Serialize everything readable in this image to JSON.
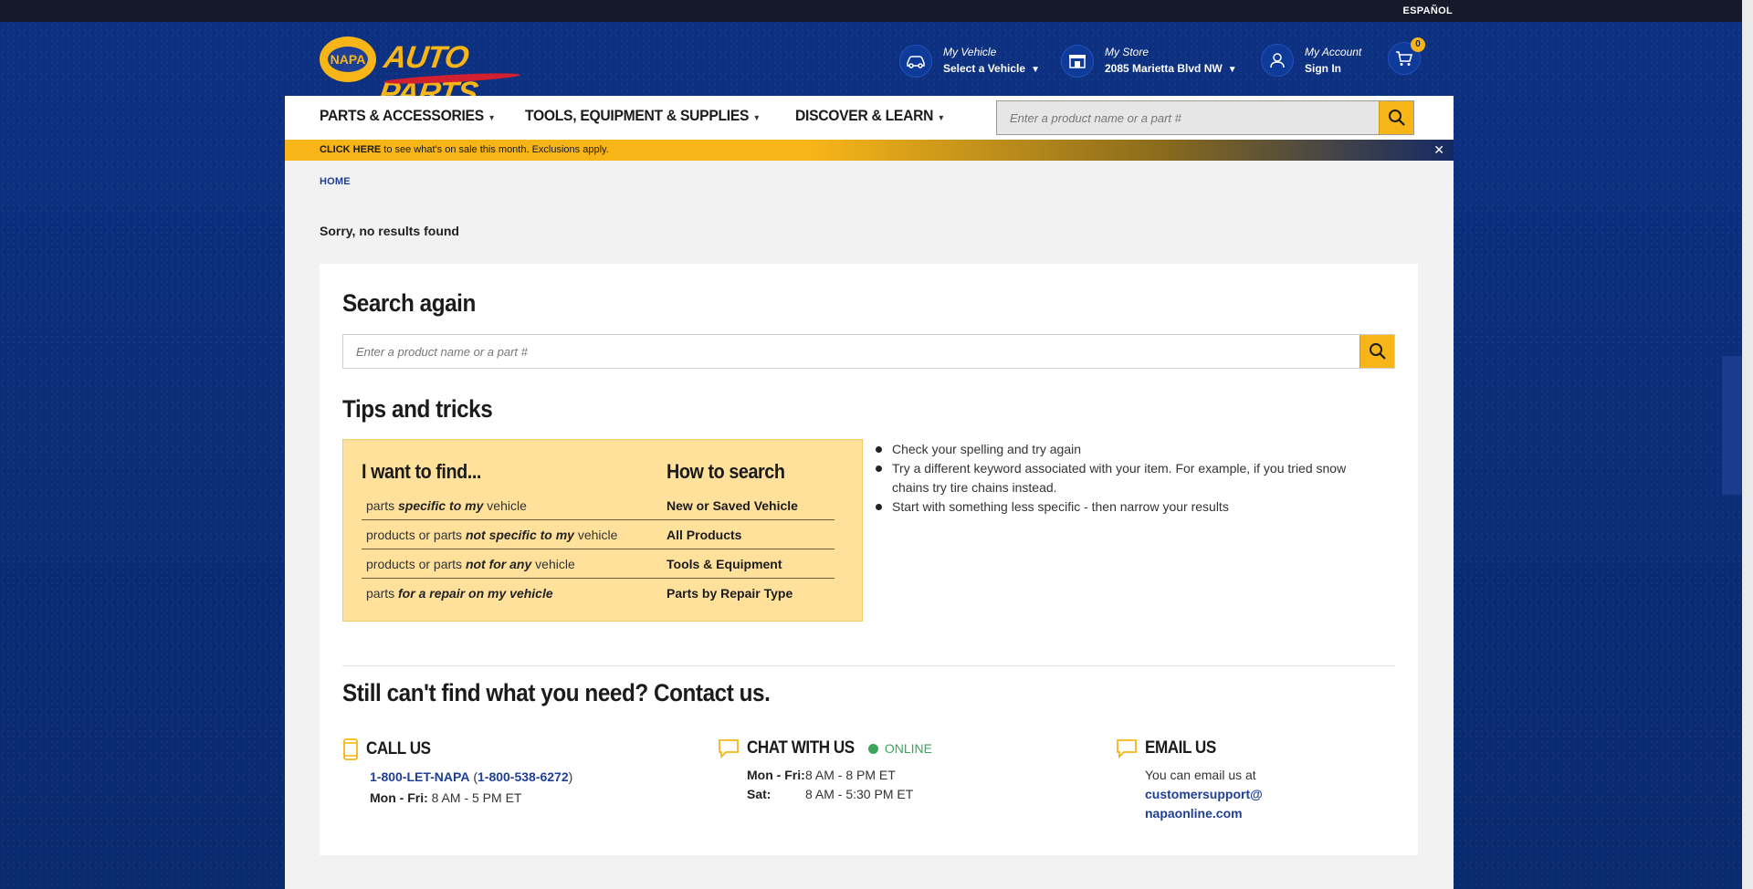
{
  "topbar": {
    "language": "ESPAÑOL"
  },
  "logo": {
    "badge": "NAPA",
    "text": "AUTO PARTS"
  },
  "header": {
    "vehicle": {
      "label": "My Vehicle",
      "value": "Select a Vehicle"
    },
    "store": {
      "label": "My Store",
      "value": "2085 Marietta Blvd NW"
    },
    "account": {
      "label": "My Account",
      "value": "Sign In"
    },
    "cart_count": "0"
  },
  "nav": {
    "items": [
      "PARTS & ACCESSORIES",
      "TOOLS, EQUIPMENT & SUPPLIES",
      "DISCOVER & LEARN"
    ],
    "search_placeholder": "Enter a product name or a part #"
  },
  "promo": {
    "link": "CLICK HERE",
    "text": " to see what's on sale this month. Exclusions apply.",
    "close": "✕"
  },
  "breadcrumb": "HOME",
  "no_results": "Sorry, no results found",
  "search_again": {
    "title": "Search again",
    "placeholder": "Enter a product name or a part #"
  },
  "tips": {
    "title": "Tips and tricks",
    "head_left": "I want to find...",
    "head_right": "How to search",
    "rows": [
      {
        "pre": "parts ",
        "em": "specific to my",
        "post": " vehicle",
        "method": "New or Saved Vehicle"
      },
      {
        "pre": "products or parts ",
        "em": "not specific to my",
        "post": " vehicle",
        "method": "All Products"
      },
      {
        "pre": "products or parts ",
        "em": "not for any",
        "post": " vehicle",
        "method": "Tools & Equipment"
      },
      {
        "pre": "parts ",
        "em": "for a repair on my vehicle",
        "post": "",
        "method": "Parts by Repair Type"
      }
    ],
    "list": [
      "Check your spelling and try again",
      "Try a different keyword associated with your item. For example, if you tried snow chains try tire chains instead.",
      "Start with something less specific - then narrow your results"
    ]
  },
  "contact": {
    "title": "Still can't find what you need? Contact us.",
    "call": {
      "title": "CALL US",
      "phone": "1-800-LET-NAPA",
      "phone_num": "1-800-538-6272",
      "days": "Mon - Fri:",
      "hours": "8 AM - 5 PM ET"
    },
    "chat": {
      "title": "CHAT WITH US",
      "status": "ONLINE",
      "days1": "Mon - Fri:",
      "hours1": "8 AM - 8 PM ET",
      "days2": "Sat:",
      "hours2": "8 AM - 5:30 PM ET"
    },
    "email": {
      "title": "EMAIL US",
      "intro": "You can email us at",
      "addr1": "customersupport@",
      "addr2": "napaonline.com"
    }
  },
  "colors": {
    "brand_blue": "#1f3f95",
    "brand_yellow": "#f7b518",
    "online_green": "#3aa65a"
  }
}
